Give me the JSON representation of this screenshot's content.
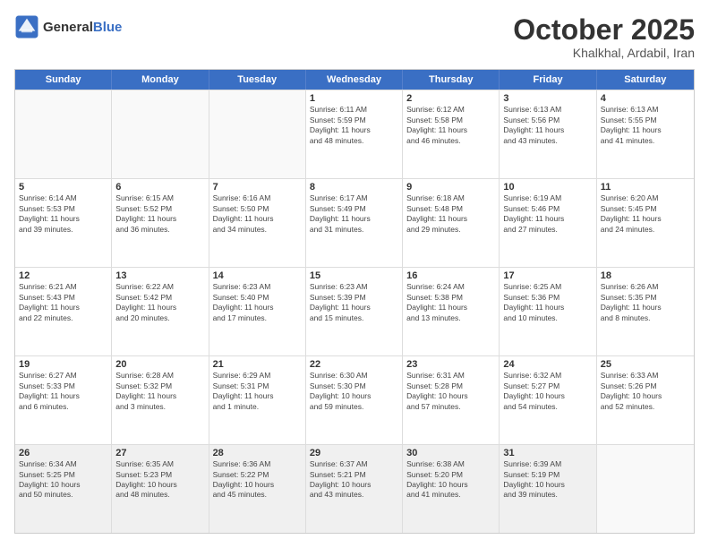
{
  "header": {
    "logo_general": "General",
    "logo_blue": "Blue",
    "month": "October 2025",
    "location": "Khalkhal, Ardabil, Iran"
  },
  "day_headers": [
    "Sunday",
    "Monday",
    "Tuesday",
    "Wednesday",
    "Thursday",
    "Friday",
    "Saturday"
  ],
  "weeks": [
    [
      {
        "num": "",
        "info": "",
        "empty": true
      },
      {
        "num": "",
        "info": "",
        "empty": true
      },
      {
        "num": "",
        "info": "",
        "empty": true
      },
      {
        "num": "1",
        "info": "Sunrise: 6:11 AM\nSunset: 5:59 PM\nDaylight: 11 hours\nand 48 minutes."
      },
      {
        "num": "2",
        "info": "Sunrise: 6:12 AM\nSunset: 5:58 PM\nDaylight: 11 hours\nand 46 minutes."
      },
      {
        "num": "3",
        "info": "Sunrise: 6:13 AM\nSunset: 5:56 PM\nDaylight: 11 hours\nand 43 minutes."
      },
      {
        "num": "4",
        "info": "Sunrise: 6:13 AM\nSunset: 5:55 PM\nDaylight: 11 hours\nand 41 minutes."
      }
    ],
    [
      {
        "num": "5",
        "info": "Sunrise: 6:14 AM\nSunset: 5:53 PM\nDaylight: 11 hours\nand 39 minutes."
      },
      {
        "num": "6",
        "info": "Sunrise: 6:15 AM\nSunset: 5:52 PM\nDaylight: 11 hours\nand 36 minutes."
      },
      {
        "num": "7",
        "info": "Sunrise: 6:16 AM\nSunset: 5:50 PM\nDaylight: 11 hours\nand 34 minutes."
      },
      {
        "num": "8",
        "info": "Sunrise: 6:17 AM\nSunset: 5:49 PM\nDaylight: 11 hours\nand 31 minutes."
      },
      {
        "num": "9",
        "info": "Sunrise: 6:18 AM\nSunset: 5:48 PM\nDaylight: 11 hours\nand 29 minutes."
      },
      {
        "num": "10",
        "info": "Sunrise: 6:19 AM\nSunset: 5:46 PM\nDaylight: 11 hours\nand 27 minutes."
      },
      {
        "num": "11",
        "info": "Sunrise: 6:20 AM\nSunset: 5:45 PM\nDaylight: 11 hours\nand 24 minutes."
      }
    ],
    [
      {
        "num": "12",
        "info": "Sunrise: 6:21 AM\nSunset: 5:43 PM\nDaylight: 11 hours\nand 22 minutes."
      },
      {
        "num": "13",
        "info": "Sunrise: 6:22 AM\nSunset: 5:42 PM\nDaylight: 11 hours\nand 20 minutes."
      },
      {
        "num": "14",
        "info": "Sunrise: 6:23 AM\nSunset: 5:40 PM\nDaylight: 11 hours\nand 17 minutes."
      },
      {
        "num": "15",
        "info": "Sunrise: 6:23 AM\nSunset: 5:39 PM\nDaylight: 11 hours\nand 15 minutes."
      },
      {
        "num": "16",
        "info": "Sunrise: 6:24 AM\nSunset: 5:38 PM\nDaylight: 11 hours\nand 13 minutes."
      },
      {
        "num": "17",
        "info": "Sunrise: 6:25 AM\nSunset: 5:36 PM\nDaylight: 11 hours\nand 10 minutes."
      },
      {
        "num": "18",
        "info": "Sunrise: 6:26 AM\nSunset: 5:35 PM\nDaylight: 11 hours\nand 8 minutes."
      }
    ],
    [
      {
        "num": "19",
        "info": "Sunrise: 6:27 AM\nSunset: 5:33 PM\nDaylight: 11 hours\nand 6 minutes."
      },
      {
        "num": "20",
        "info": "Sunrise: 6:28 AM\nSunset: 5:32 PM\nDaylight: 11 hours\nand 3 minutes."
      },
      {
        "num": "21",
        "info": "Sunrise: 6:29 AM\nSunset: 5:31 PM\nDaylight: 11 hours\nand 1 minute."
      },
      {
        "num": "22",
        "info": "Sunrise: 6:30 AM\nSunset: 5:30 PM\nDaylight: 10 hours\nand 59 minutes."
      },
      {
        "num": "23",
        "info": "Sunrise: 6:31 AM\nSunset: 5:28 PM\nDaylight: 10 hours\nand 57 minutes."
      },
      {
        "num": "24",
        "info": "Sunrise: 6:32 AM\nSunset: 5:27 PM\nDaylight: 10 hours\nand 54 minutes."
      },
      {
        "num": "25",
        "info": "Sunrise: 6:33 AM\nSunset: 5:26 PM\nDaylight: 10 hours\nand 52 minutes."
      }
    ],
    [
      {
        "num": "26",
        "info": "Sunrise: 6:34 AM\nSunset: 5:25 PM\nDaylight: 10 hours\nand 50 minutes."
      },
      {
        "num": "27",
        "info": "Sunrise: 6:35 AM\nSunset: 5:23 PM\nDaylight: 10 hours\nand 48 minutes."
      },
      {
        "num": "28",
        "info": "Sunrise: 6:36 AM\nSunset: 5:22 PM\nDaylight: 10 hours\nand 45 minutes."
      },
      {
        "num": "29",
        "info": "Sunrise: 6:37 AM\nSunset: 5:21 PM\nDaylight: 10 hours\nand 43 minutes."
      },
      {
        "num": "30",
        "info": "Sunrise: 6:38 AM\nSunset: 5:20 PM\nDaylight: 10 hours\nand 41 minutes."
      },
      {
        "num": "31",
        "info": "Sunrise: 6:39 AM\nSunset: 5:19 PM\nDaylight: 10 hours\nand 39 minutes."
      },
      {
        "num": "",
        "info": "",
        "empty": true
      }
    ]
  ]
}
